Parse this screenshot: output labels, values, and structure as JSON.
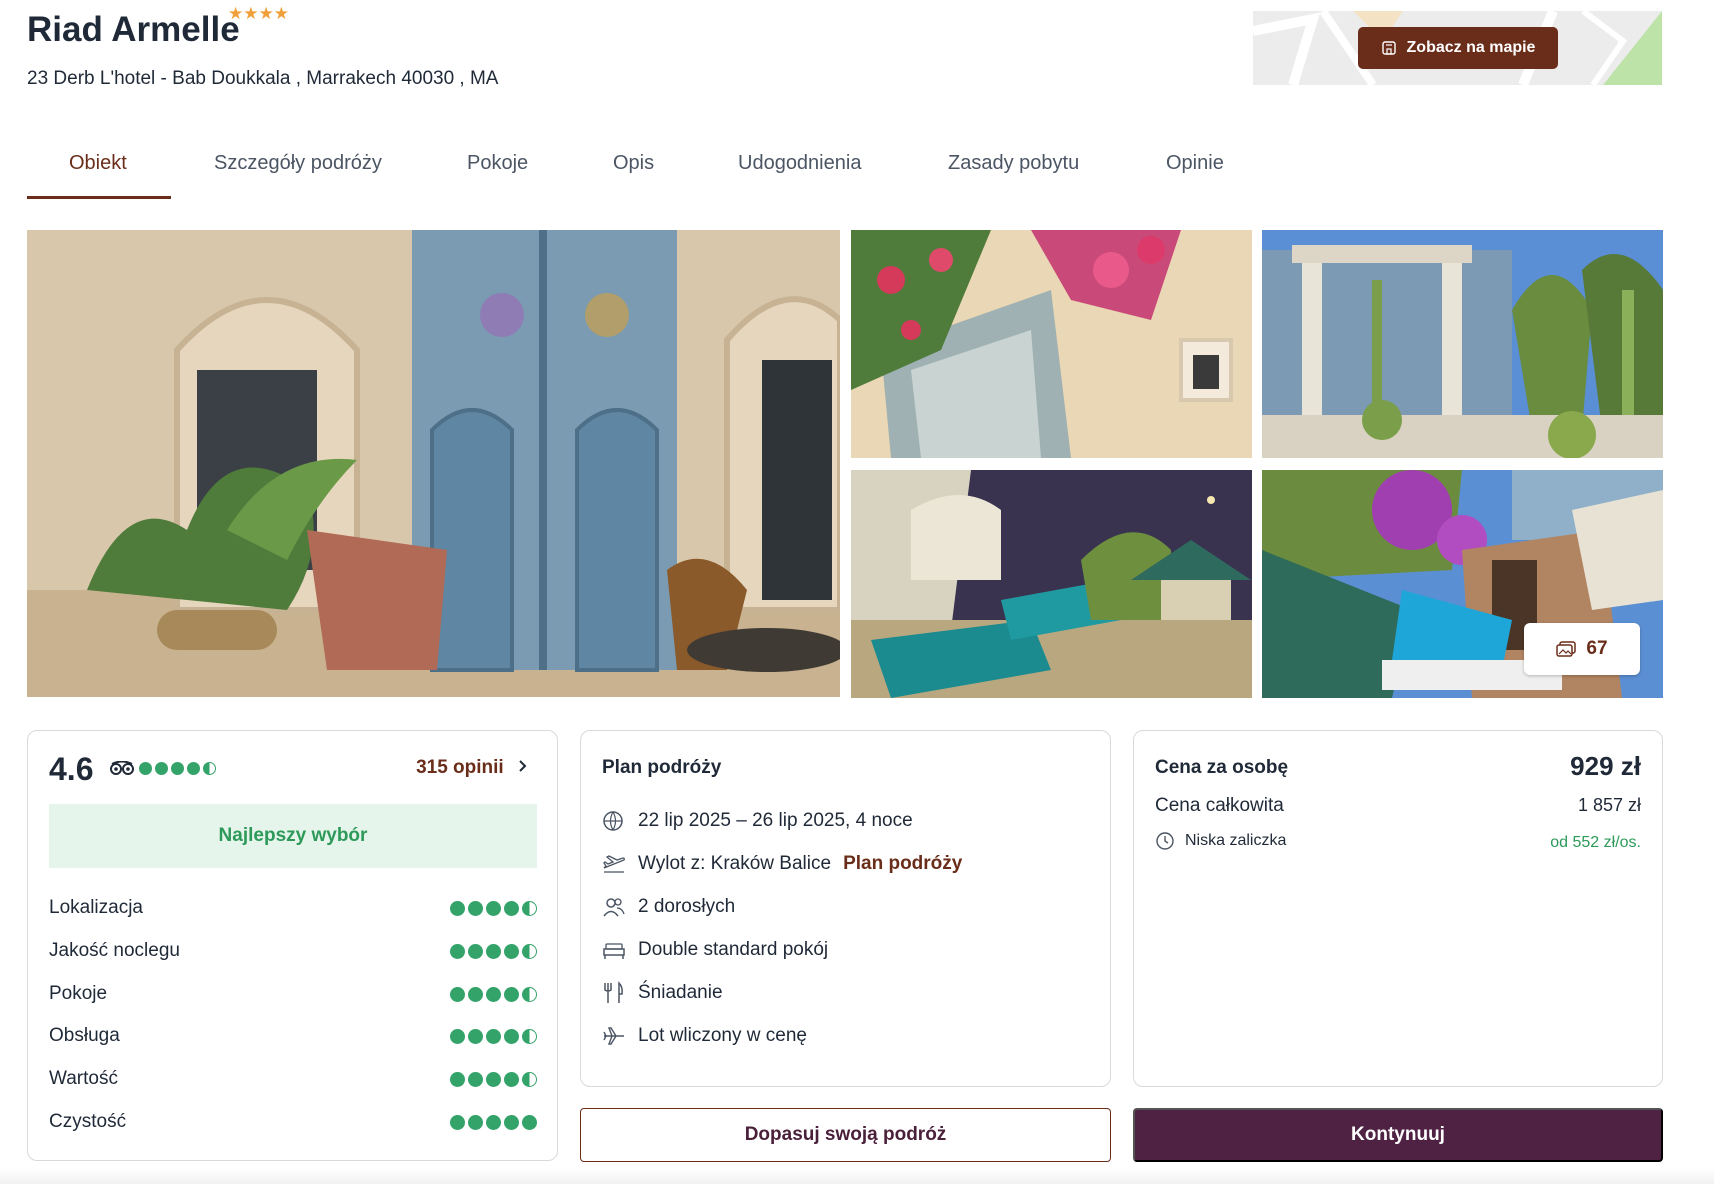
{
  "hotel": {
    "name": "Riad Armelle",
    "stars": "★★★★",
    "address": "23 Derb L'hotel - Bab Doukkala , Marrakech 40030 , MA"
  },
  "map": {
    "button_label": "Zobacz na mapie",
    "icon": "building-icon"
  },
  "tabs": [
    {
      "label": "Obiekt",
      "active": true
    },
    {
      "label": "Szczegóły podróży"
    },
    {
      "label": "Pokoje"
    },
    {
      "label": "Opis"
    },
    {
      "label": "Udogodnienia"
    },
    {
      "label": "Zasady pobytu"
    },
    {
      "label": "Opinie"
    }
  ],
  "gallery": {
    "photo_count": "67",
    "photos": [
      "courtyard-photo",
      "bougainvillea-photo",
      "rooftop-cactus-photo",
      "rooftop-loungers-photo",
      "terrace-photo"
    ]
  },
  "rating": {
    "score": "4.6",
    "score_dots": 4.5,
    "reviews_link": "315 opinii",
    "badge": "Najlepszy wybór",
    "categories": [
      {
        "label": "Lokalizacja",
        "dots": 4.5
      },
      {
        "label": "Jakość noclegu",
        "dots": 4.5
      },
      {
        "label": "Pokoje",
        "dots": 4.5
      },
      {
        "label": "Obsługa",
        "dots": 4.5
      },
      {
        "label": "Wartość",
        "dots": 4.5
      },
      {
        "label": "Czystość",
        "dots": 5
      }
    ]
  },
  "plan": {
    "title": "Plan podróży",
    "dates": "22 lip 2025 – 26 lip 2025, 4 noce",
    "departure": "Wylot z: Kraków Balice",
    "departure_link": "Plan podróży",
    "guests": "2 dorosłych",
    "room": "Double standard pokój",
    "board": "Śniadanie",
    "flight": "Lot wliczony w cenę"
  },
  "price": {
    "per_person_label": "Cena za osobę",
    "per_person_value": "929 zł",
    "total_label": "Cena całkowita",
    "total_value": "1 857 zł",
    "deposit_label": "Niska zaliczka",
    "deposit_value": "od 552 zł/os."
  },
  "actions": {
    "customize_label": "Dopasuj swoją podróż",
    "continue_label": "Kontynuuj"
  },
  "colors": {
    "brand": "#6a2d1a",
    "primary_button": "#4f2143",
    "rating_green": "#34a36a",
    "badge_bg": "#e6f5ec",
    "star": "#f0a03a"
  }
}
